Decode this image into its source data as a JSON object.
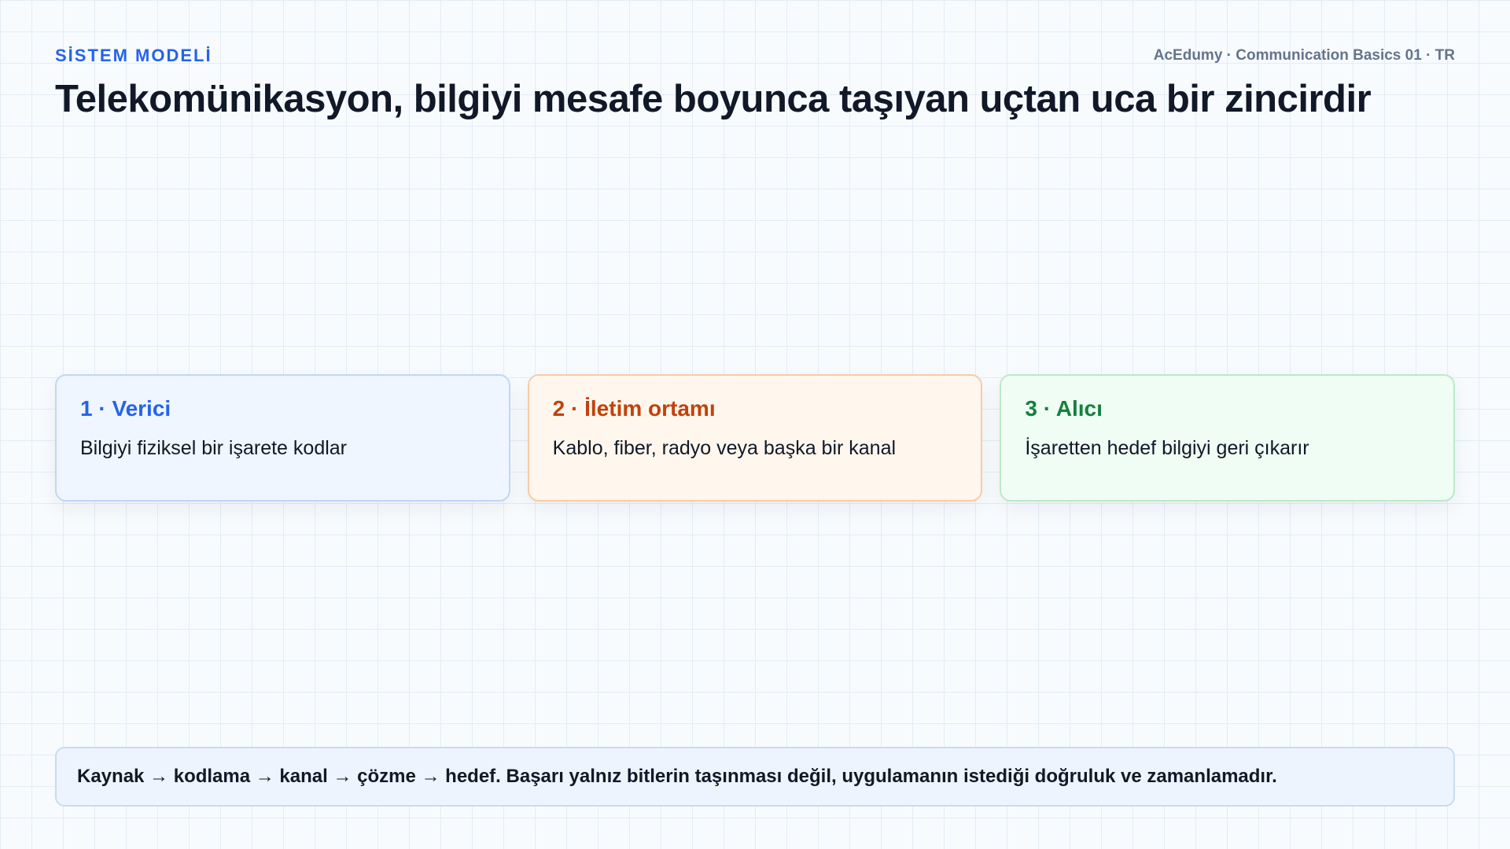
{
  "header": {
    "eyebrow": "SİSTEM MODELİ",
    "meta": "AcEdumy · Communication Basics 01 · TR",
    "title": "Telekomünikasyon, bilgiyi mesafe boyunca taşıyan uçtan uca bir zincirdir"
  },
  "cards": [
    {
      "title": "1 · Verici",
      "body": "Bilgiyi fiziksel bir işarete kodlar",
      "color": "#2563eb"
    },
    {
      "title": "2 · İletim ortamı",
      "body": "Kablo, fiber, radyo veya başka bir kanal",
      "color": "#c2410c"
    },
    {
      "title": "3 · Alıcı",
      "body": "İşaretten hedef bilgiyi geri çıkarır",
      "color": "#15803d"
    }
  ],
  "footer": {
    "text": "Kaynak → kodlama → kanal → çözme → hedef. Başarı yalnız bitlerin taşınması değil, uygulamanın istediği doğruluk ve zamanlamadır."
  }
}
